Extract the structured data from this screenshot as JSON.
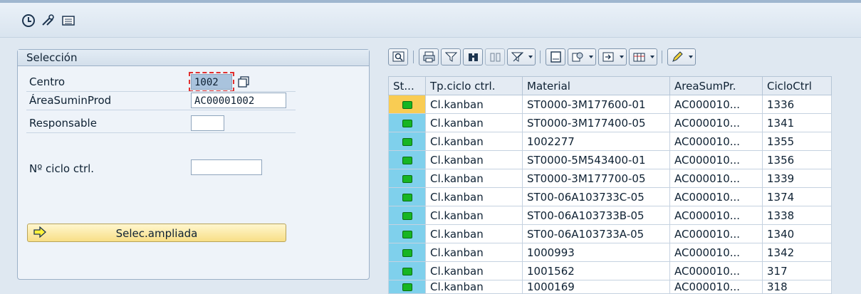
{
  "toolbar_icons": [
    "execute-icon",
    "get-variant-icon",
    "selection-options-icon"
  ],
  "selection": {
    "title": "Selección",
    "fields": [
      {
        "label": "Centro",
        "value": "1002"
      },
      {
        "label": "ÁreaSuminProd",
        "value": "AC00001002"
      },
      {
        "label": "Responsable",
        "value": ""
      },
      {
        "label": "Nº ciclo ctrl.",
        "value": ""
      }
    ],
    "extended_button": "Selec.ampliada"
  },
  "grid": {
    "columns": [
      "St...",
      "Tp.ciclo ctrl.",
      "Material",
      "AreaSumPr.",
      "CicloCtrl"
    ],
    "rows": [
      {
        "type": "Cl.kanban",
        "material": "ST0000-3M177600-01",
        "area": "AC000010...",
        "cycle": "1336"
      },
      {
        "type": "Cl.kanban",
        "material": "ST0000-3M177400-05",
        "area": "AC000010...",
        "cycle": "1341"
      },
      {
        "type": "Cl.kanban",
        "material": "1002277",
        "area": "AC000010...",
        "cycle": "1355"
      },
      {
        "type": "Cl.kanban",
        "material": "ST0000-5M543400-01",
        "area": "AC000010...",
        "cycle": "1356"
      },
      {
        "type": "Cl.kanban",
        "material": "ST0000-3M177700-05",
        "area": "AC000010...",
        "cycle": "1339"
      },
      {
        "type": "Cl.kanban",
        "material": "ST00-06A103733C-05",
        "area": "AC000010...",
        "cycle": "1374"
      },
      {
        "type": "Cl.kanban",
        "material": "ST00-06A103733B-05",
        "area": "AC000010...",
        "cycle": "1338"
      },
      {
        "type": "Cl.kanban",
        "material": "ST00-06A103733A-05",
        "area": "AC000010...",
        "cycle": "1340"
      },
      {
        "type": "Cl.kanban",
        "material": "1000993",
        "area": "AC000010...",
        "cycle": "1342"
      },
      {
        "type": "Cl.kanban",
        "material": "1001562",
        "area": "AC000010...",
        "cycle": "317"
      },
      {
        "type": "Cl.kanban",
        "material": "1000169",
        "area": "AC000010...",
        "cycle": "318"
      }
    ]
  },
  "colors": {
    "status_green": "#17b523",
    "selected_status": "#f9cc53",
    "status_cell": "#7fd0ec"
  }
}
